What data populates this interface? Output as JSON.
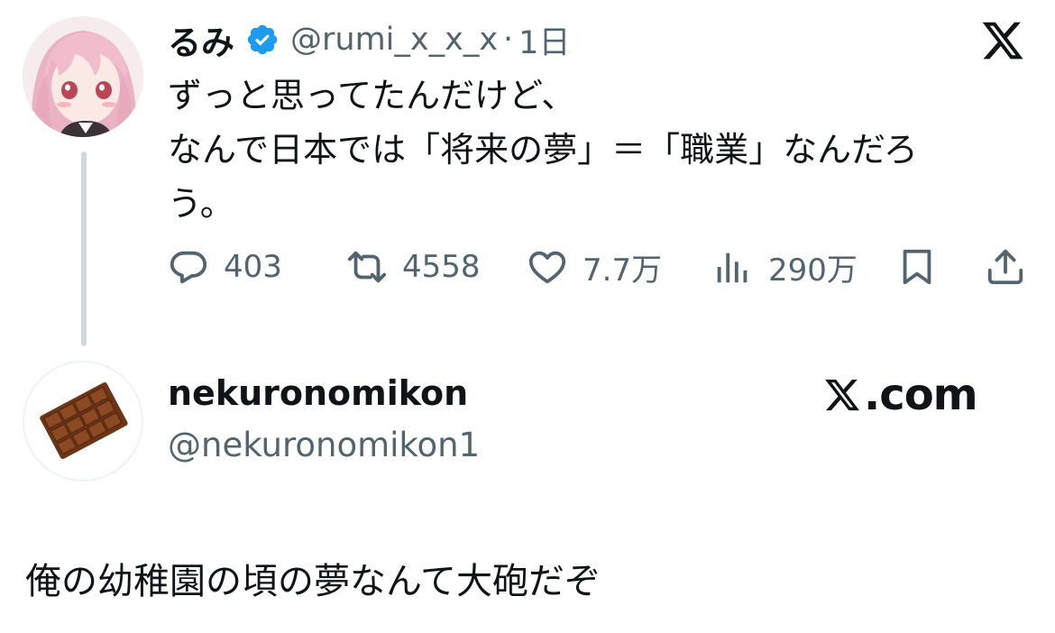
{
  "quoted_tweet": {
    "author_name": "るみ",
    "verified": true,
    "handle": "@rumi_x_x_x",
    "separator": "·",
    "time": "1日",
    "text_lines": [
      "ずっと思ってたんだけど、",
      "なんで日本では「将来の夢」＝「職業」なんだろ",
      "う。"
    ],
    "actions": {
      "replies": "403",
      "reposts": "4558",
      "likes": "7.7万",
      "views": "290万"
    }
  },
  "reply_tweet": {
    "author_name": "nekuronomikon",
    "handle": "@nekuronomikon1",
    "text": "俺の幼稚園の頃の夢なんて大砲だぞ"
  },
  "watermark": {
    "text": ".com"
  },
  "colors": {
    "text_primary": "#0f1419",
    "text_secondary": "#536471",
    "verified_blue": "#1d9bf0",
    "thread_line": "#cfd9de",
    "chocolate": "#7b3f1c"
  }
}
